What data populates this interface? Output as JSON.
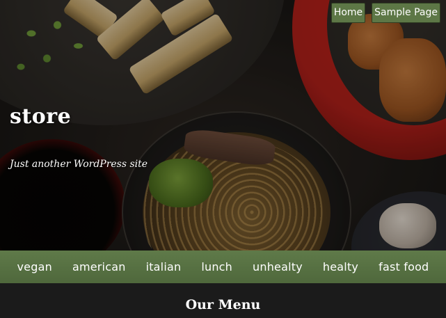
{
  "header": {
    "site_title": "store",
    "tagline": "Just another WordPress site"
  },
  "top_nav": {
    "items": [
      {
        "label": "Home"
      },
      {
        "label": "Sample Page"
      }
    ]
  },
  "categories": {
    "items": [
      {
        "label": "vegan"
      },
      {
        "label": "american"
      },
      {
        "label": "italian"
      },
      {
        "label": "lunch"
      },
      {
        "label": "unhealty"
      },
      {
        "label": "healty"
      },
      {
        "label": "fast food"
      }
    ]
  },
  "menu_section": {
    "heading": "Our Menu"
  },
  "colors": {
    "nav_green": "#5d7746",
    "category_bar_green": "#5f7a49",
    "page_background": "#1b1b1b",
    "text": "#ffffff"
  }
}
